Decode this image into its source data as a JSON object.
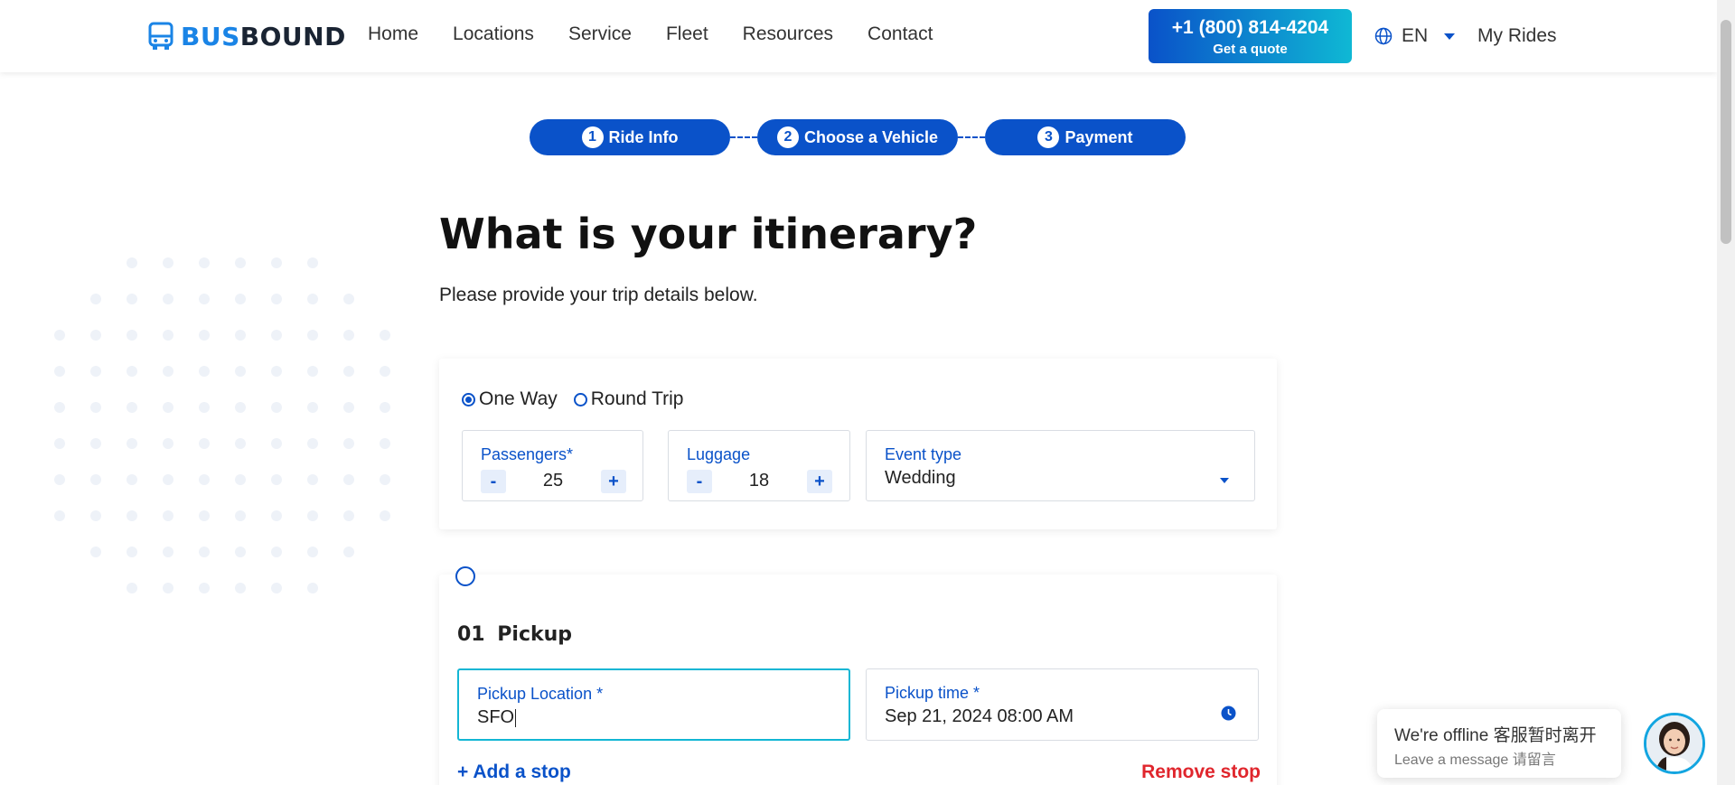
{
  "header": {
    "logo": {
      "bus": "BUS",
      "bound": "BOUND"
    },
    "nav": [
      "Home",
      "Locations",
      "Service",
      "Fleet",
      "Resources",
      "Contact"
    ],
    "phone": {
      "number": "+1 (800) 814-4204",
      "sub": "Get a quote"
    },
    "language": "EN",
    "my_rides": "My Rides"
  },
  "steps": [
    {
      "num": "1",
      "label": "Ride Info"
    },
    {
      "num": "2",
      "label": "Choose a Vehicle"
    },
    {
      "num": "3",
      "label": "Payment"
    }
  ],
  "page": {
    "title": "What is your itinerary?",
    "subtitle": "Please provide your trip details below."
  },
  "trip": {
    "one_way": "One Way",
    "round_trip": "Round Trip",
    "selected": "One Way",
    "passengers": {
      "label": "Passengers*",
      "value": "25",
      "minus": "-",
      "plus": "+"
    },
    "luggage": {
      "label": "Luggage",
      "value": "18",
      "minus": "-",
      "plus": "+"
    },
    "event_type": {
      "label": "Event type",
      "value": "Wedding"
    }
  },
  "pickup": {
    "num": "01",
    "title": "Pickup",
    "location": {
      "label": "Pickup Location *",
      "value": "SFO"
    },
    "time": {
      "label": "Pickup time *",
      "value": "Sep 21, 2024 08:00 AM"
    },
    "add_stop": "+ Add a stop",
    "remove_stop": "Remove stop"
  },
  "chat": {
    "line1": "We're offline 客服暂时离开",
    "line2": "Leave a message 请留言"
  },
  "colors": {
    "primary": "#0a52c9",
    "accent": "#13b6d4",
    "danger": "#e0262d"
  }
}
